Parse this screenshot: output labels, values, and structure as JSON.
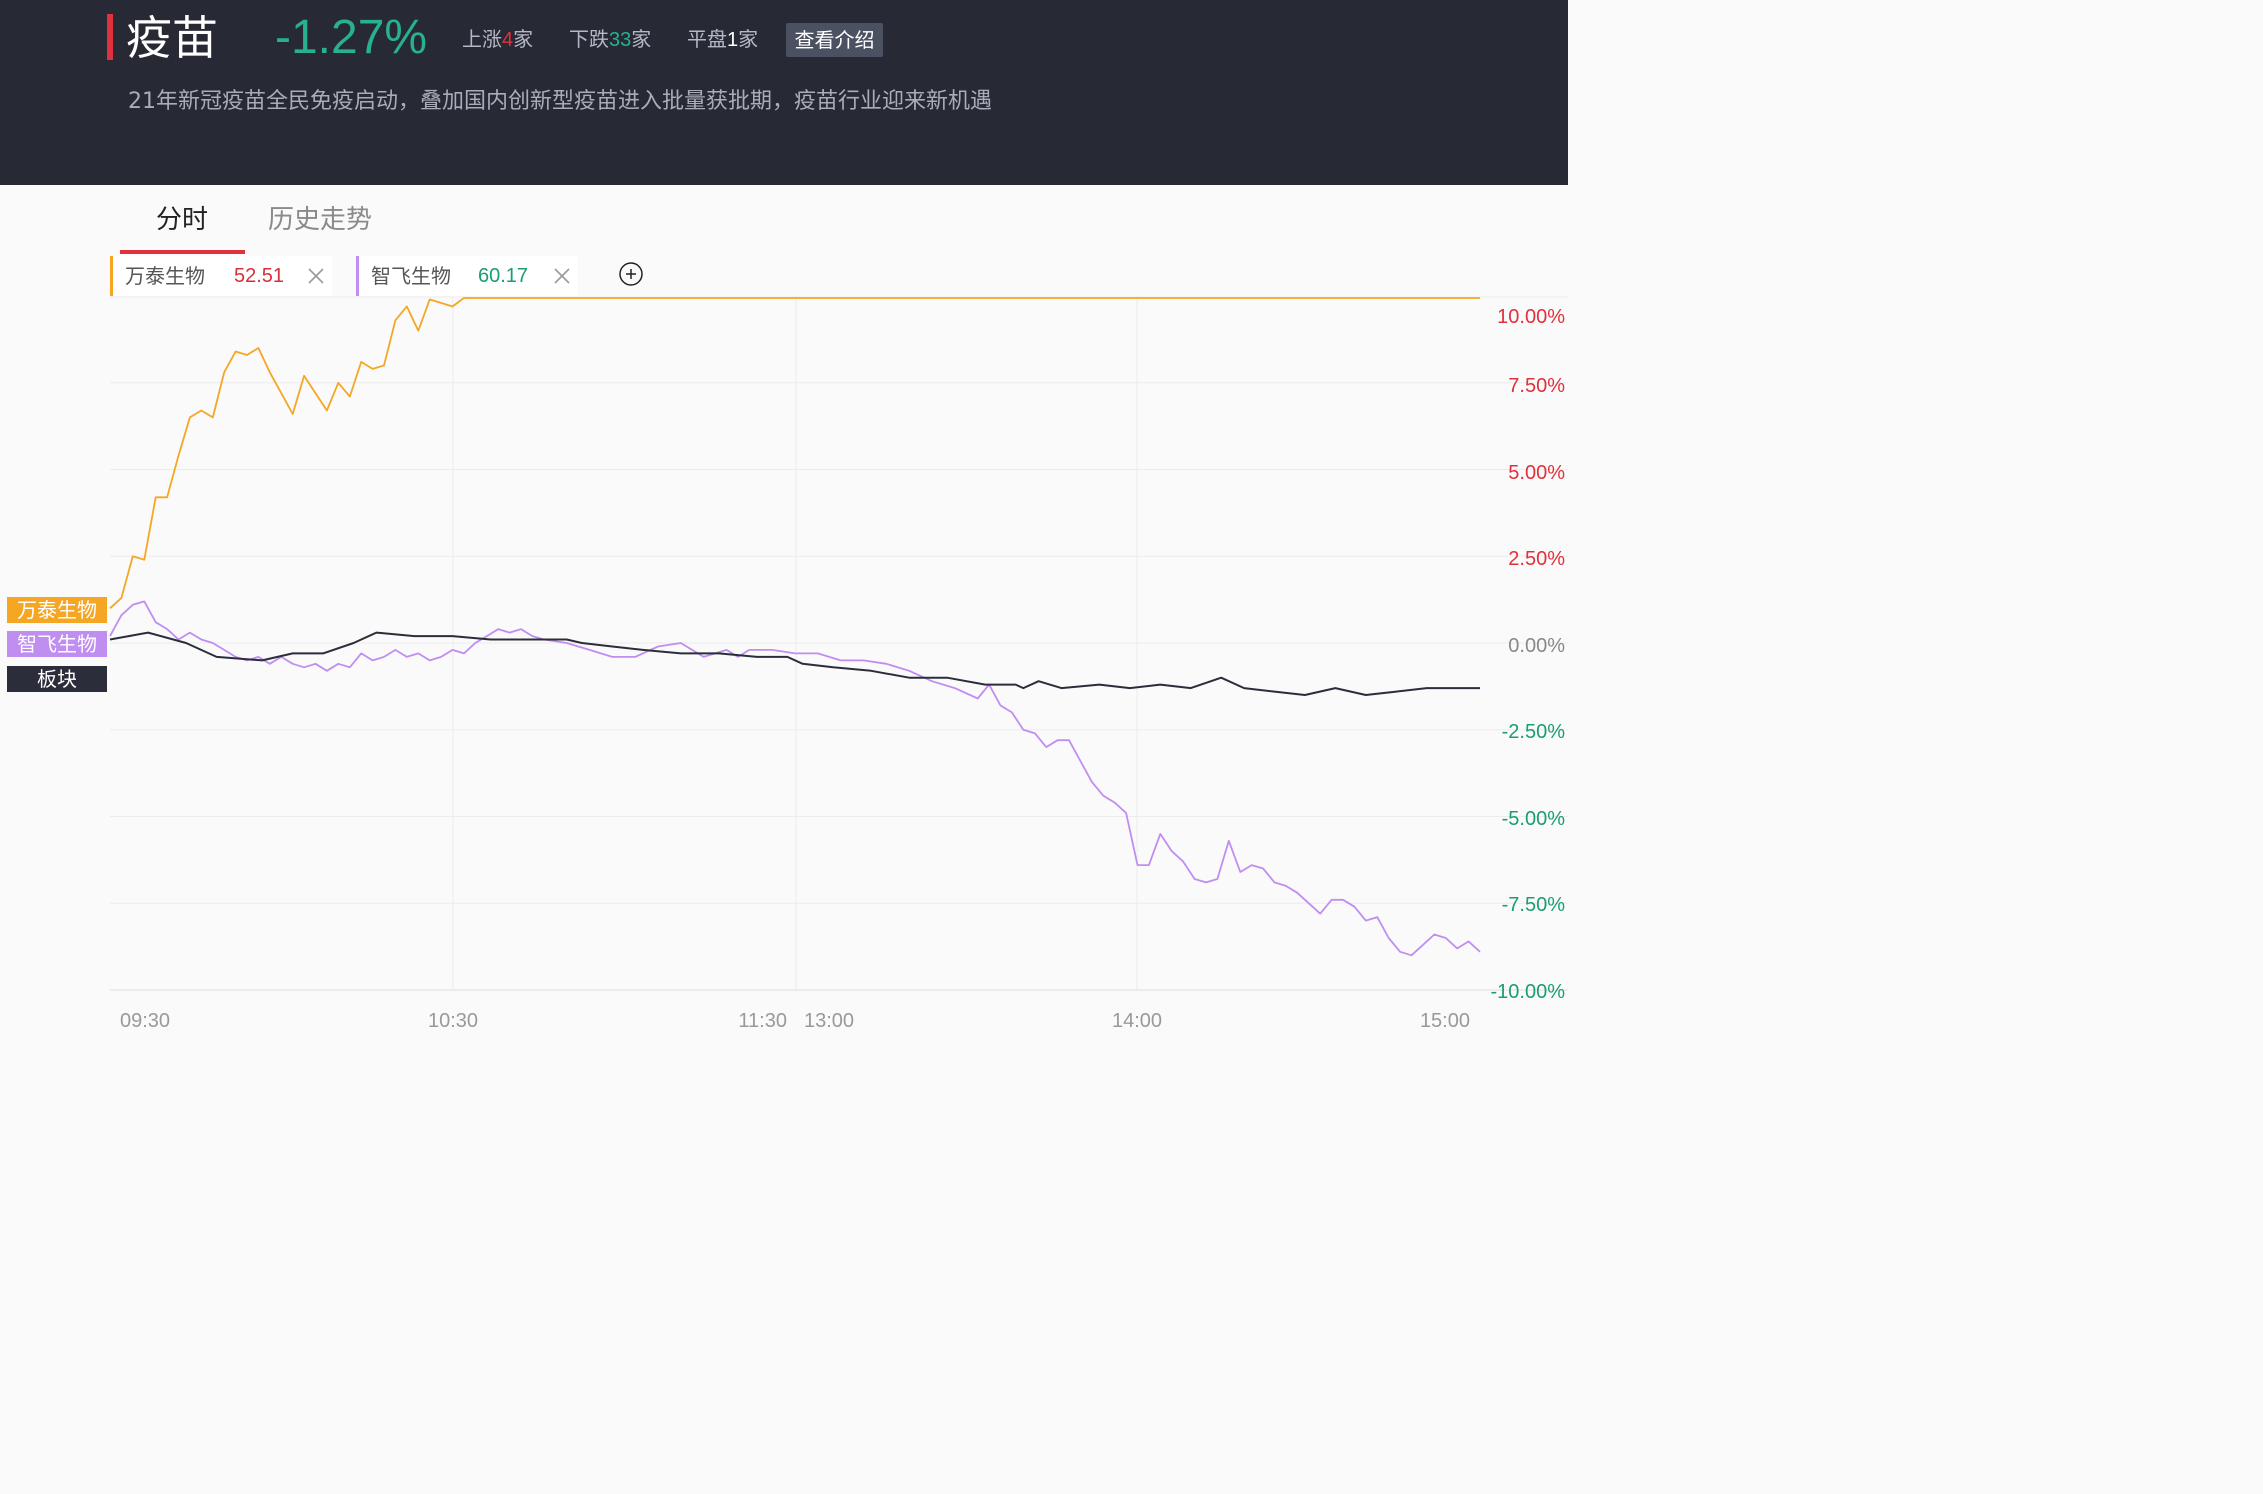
{
  "header": {
    "title": "疫苗",
    "change_pct": "-1.27%",
    "stats": {
      "up_label": "上涨",
      "up_count": "4",
      "up_unit": "家",
      "down_label": "下跌",
      "down_count": "33",
      "down_unit": "家",
      "flat_label": "平盘",
      "flat_count": "1",
      "flat_unit": "家"
    },
    "intro_button": "查看介绍",
    "description": "21年新冠疫苗全民免疫启动，叠加国内创新型疫苗进入批量获批期，疫苗行业迎来新机遇"
  },
  "tabs": {
    "active": "分时",
    "inactive": "历史走势"
  },
  "stock_tags": [
    {
      "name": "万泰生物",
      "price": "52.51",
      "price_color": "#d6303b",
      "bar_color": "#f5a623"
    },
    {
      "name": "智飞生物",
      "price": "60.17",
      "price_color": "#1a9e6e",
      "bar_color": "#c08ef0"
    }
  ],
  "legend": [
    {
      "label": "万泰生物",
      "color": "#f5a623"
    },
    {
      "label": "智飞生物",
      "color": "#c08ef0"
    },
    {
      "label": "板块",
      "color": "#2b2e3a"
    }
  ],
  "colors": {
    "header_bg": "#272935",
    "accent": "#e0313c",
    "up": "#e0313c",
    "down": "#1a9e6e",
    "grid": "#e6e6e6",
    "axis_text": "#999999"
  },
  "chart_data": {
    "type": "line",
    "x_ticks": [
      "09:30",
      "10:30",
      "11:30",
      "13:00",
      "14:00",
      "15:00"
    ],
    "y_ticks": [
      "10.00%",
      "7.50%",
      "5.00%",
      "2.50%",
      "0.00%",
      "-2.50%",
      "-5.00%",
      "-7.50%",
      "-10.00%"
    ],
    "y_tick_values": [
      10,
      7.5,
      5,
      2.5,
      0,
      -2.5,
      -5,
      -7.5,
      -10
    ],
    "ylim": [
      -10,
      10
    ],
    "x_minutes_total": 240,
    "series": [
      {
        "name": "万泰生物",
        "color": "#f5a623",
        "points": [
          [
            0,
            1.0
          ],
          [
            2,
            1.3
          ],
          [
            4,
            2.5
          ],
          [
            6,
            2.4
          ],
          [
            8,
            4.2
          ],
          [
            10,
            4.2
          ],
          [
            12,
            5.4
          ],
          [
            14,
            6.5
          ],
          [
            16,
            6.7
          ],
          [
            18,
            6.5
          ],
          [
            20,
            7.8
          ],
          [
            22,
            8.4
          ],
          [
            24,
            8.3
          ],
          [
            26,
            8.5
          ],
          [
            28,
            7.8
          ],
          [
            30,
            7.2
          ],
          [
            32,
            6.6
          ],
          [
            34,
            7.7
          ],
          [
            36,
            7.2
          ],
          [
            38,
            6.7
          ],
          [
            40,
            7.5
          ],
          [
            42,
            7.1
          ],
          [
            44,
            8.1
          ],
          [
            46,
            7.9
          ],
          [
            48,
            8.0
          ],
          [
            50,
            9.3
          ],
          [
            52,
            9.7
          ],
          [
            54,
            9.0
          ],
          [
            56,
            9.9
          ],
          [
            58,
            9.8
          ],
          [
            60,
            10.0
          ],
          [
            62,
            10.5
          ],
          [
            240,
            10.5
          ]
        ]
      },
      {
        "name": "智飞生物",
        "color": "#c08ef0",
        "points": [
          [
            0,
            0.2
          ],
          [
            2,
            0.8
          ],
          [
            4,
            1.1
          ],
          [
            6,
            1.2
          ],
          [
            8,
            0.6
          ],
          [
            10,
            0.4
          ],
          [
            12,
            0.1
          ],
          [
            14,
            0.3
          ],
          [
            16,
            0.1
          ],
          [
            18,
            0.0
          ],
          [
            20,
            -0.2
          ],
          [
            22,
            -0.4
          ],
          [
            24,
            -0.5
          ],
          [
            26,
            -0.4
          ],
          [
            28,
            -0.6
          ],
          [
            30,
            -0.4
          ],
          [
            32,
            -0.6
          ],
          [
            34,
            -0.7
          ],
          [
            36,
            -0.6
          ],
          [
            38,
            -0.8
          ],
          [
            40,
            -0.6
          ],
          [
            42,
            -0.7
          ],
          [
            44,
            -0.3
          ],
          [
            46,
            -0.5
          ],
          [
            48,
            -0.4
          ],
          [
            50,
            -0.2
          ],
          [
            52,
            -0.4
          ],
          [
            54,
            -0.3
          ],
          [
            56,
            -0.5
          ],
          [
            58,
            -0.4
          ],
          [
            60,
            -0.2
          ],
          [
            62,
            -0.3
          ],
          [
            64,
            0.0
          ],
          [
            66,
            0.2
          ],
          [
            68,
            0.4
          ],
          [
            70,
            0.3
          ],
          [
            72,
            0.4
          ],
          [
            74,
            0.2
          ],
          [
            76,
            0.1
          ],
          [
            80,
            0.0
          ],
          [
            84,
            -0.2
          ],
          [
            88,
            -0.4
          ],
          [
            92,
            -0.4
          ],
          [
            96,
            -0.1
          ],
          [
            100,
            0.0
          ],
          [
            104,
            -0.4
          ],
          [
            108,
            -0.2
          ],
          [
            110,
            -0.4
          ],
          [
            112,
            -0.2
          ],
          [
            116,
            -0.2
          ],
          [
            120,
            -0.3
          ],
          [
            124,
            -0.3
          ],
          [
            128,
            -0.5
          ],
          [
            132,
            -0.5
          ],
          [
            136,
            -0.6
          ],
          [
            140,
            -0.8
          ],
          [
            144,
            -1.1
          ],
          [
            148,
            -1.3
          ],
          [
            152,
            -1.6
          ],
          [
            154,
            -1.2
          ],
          [
            156,
            -1.8
          ],
          [
            158,
            -2.0
          ],
          [
            160,
            -2.5
          ],
          [
            162,
            -2.6
          ],
          [
            164,
            -3.0
          ],
          [
            166,
            -2.8
          ],
          [
            168,
            -2.8
          ],
          [
            170,
            -3.4
          ],
          [
            172,
            -4.0
          ],
          [
            174,
            -4.4
          ],
          [
            176,
            -4.6
          ],
          [
            178,
            -4.9
          ],
          [
            180,
            -6.4
          ],
          [
            182,
            -6.4
          ],
          [
            184,
            -5.5
          ],
          [
            186,
            -6.0
          ],
          [
            188,
            -6.3
          ],
          [
            190,
            -6.8
          ],
          [
            192,
            -6.9
          ],
          [
            194,
            -6.8
          ],
          [
            196,
            -5.7
          ],
          [
            198,
            -6.6
          ],
          [
            200,
            -6.4
          ],
          [
            202,
            -6.5
          ],
          [
            204,
            -6.9
          ],
          [
            206,
            -7.0
          ],
          [
            208,
            -7.2
          ],
          [
            210,
            -7.5
          ],
          [
            212,
            -7.8
          ],
          [
            214,
            -7.4
          ],
          [
            216,
            -7.4
          ],
          [
            218,
            -7.6
          ],
          [
            220,
            -8.0
          ],
          [
            222,
            -7.9
          ],
          [
            224,
            -8.5
          ],
          [
            226,
            -8.9
          ],
          [
            228,
            -9.0
          ],
          [
            230,
            -8.7
          ],
          [
            232,
            -8.4
          ],
          [
            234,
            -8.5
          ],
          [
            236,
            -8.8
          ],
          [
            238,
            -8.6
          ],
          [
            240,
            -8.9
          ]
        ]
      },
      {
        "name": "板块",
        "color": "#2b2e3a",
        "points": [
          [
            0,
            0.1
          ],
          [
            10,
            0.3
          ],
          [
            20,
            0.0
          ],
          [
            28,
            -0.4
          ],
          [
            40,
            -0.5
          ],
          [
            48,
            -0.3
          ],
          [
            56,
            -0.3
          ],
          [
            64,
            0.0
          ],
          [
            70,
            0.3
          ],
          [
            80,
            0.2
          ],
          [
            90,
            0.2
          ],
          [
            100,
            0.1
          ],
          [
            110,
            0.1
          ],
          [
            120,
            0.1
          ],
          [
            124,
            0.0
          ],
          [
            132,
            -0.1
          ],
          [
            140,
            -0.2
          ],
          [
            150,
            -0.3
          ],
          [
            160,
            -0.3
          ],
          [
            170,
            -0.4
          ],
          [
            178,
            -0.4
          ],
          [
            182,
            -0.6
          ],
          [
            190,
            -0.7
          ],
          [
            200,
            -0.8
          ],
          [
            210,
            -1.0
          ],
          [
            220,
            -1.0
          ],
          [
            230,
            -1.2
          ],
          [
            238,
            -1.2
          ],
          [
            240,
            -1.3
          ],
          [
            244,
            -1.1
          ],
          [
            250,
            -1.3
          ],
          [
            260,
            -1.2
          ],
          [
            268,
            -1.3
          ],
          [
            276,
            -1.2
          ],
          [
            284,
            -1.3
          ],
          [
            292,
            -1.0
          ],
          [
            298,
            -1.3
          ],
          [
            306,
            -1.4
          ],
          [
            314,
            -1.5
          ],
          [
            322,
            -1.3
          ],
          [
            330,
            -1.5
          ],
          [
            338,
            -1.4
          ],
          [
            346,
            -1.3
          ],
          [
            360,
            -1.3
          ]
        ]
      }
    ]
  }
}
